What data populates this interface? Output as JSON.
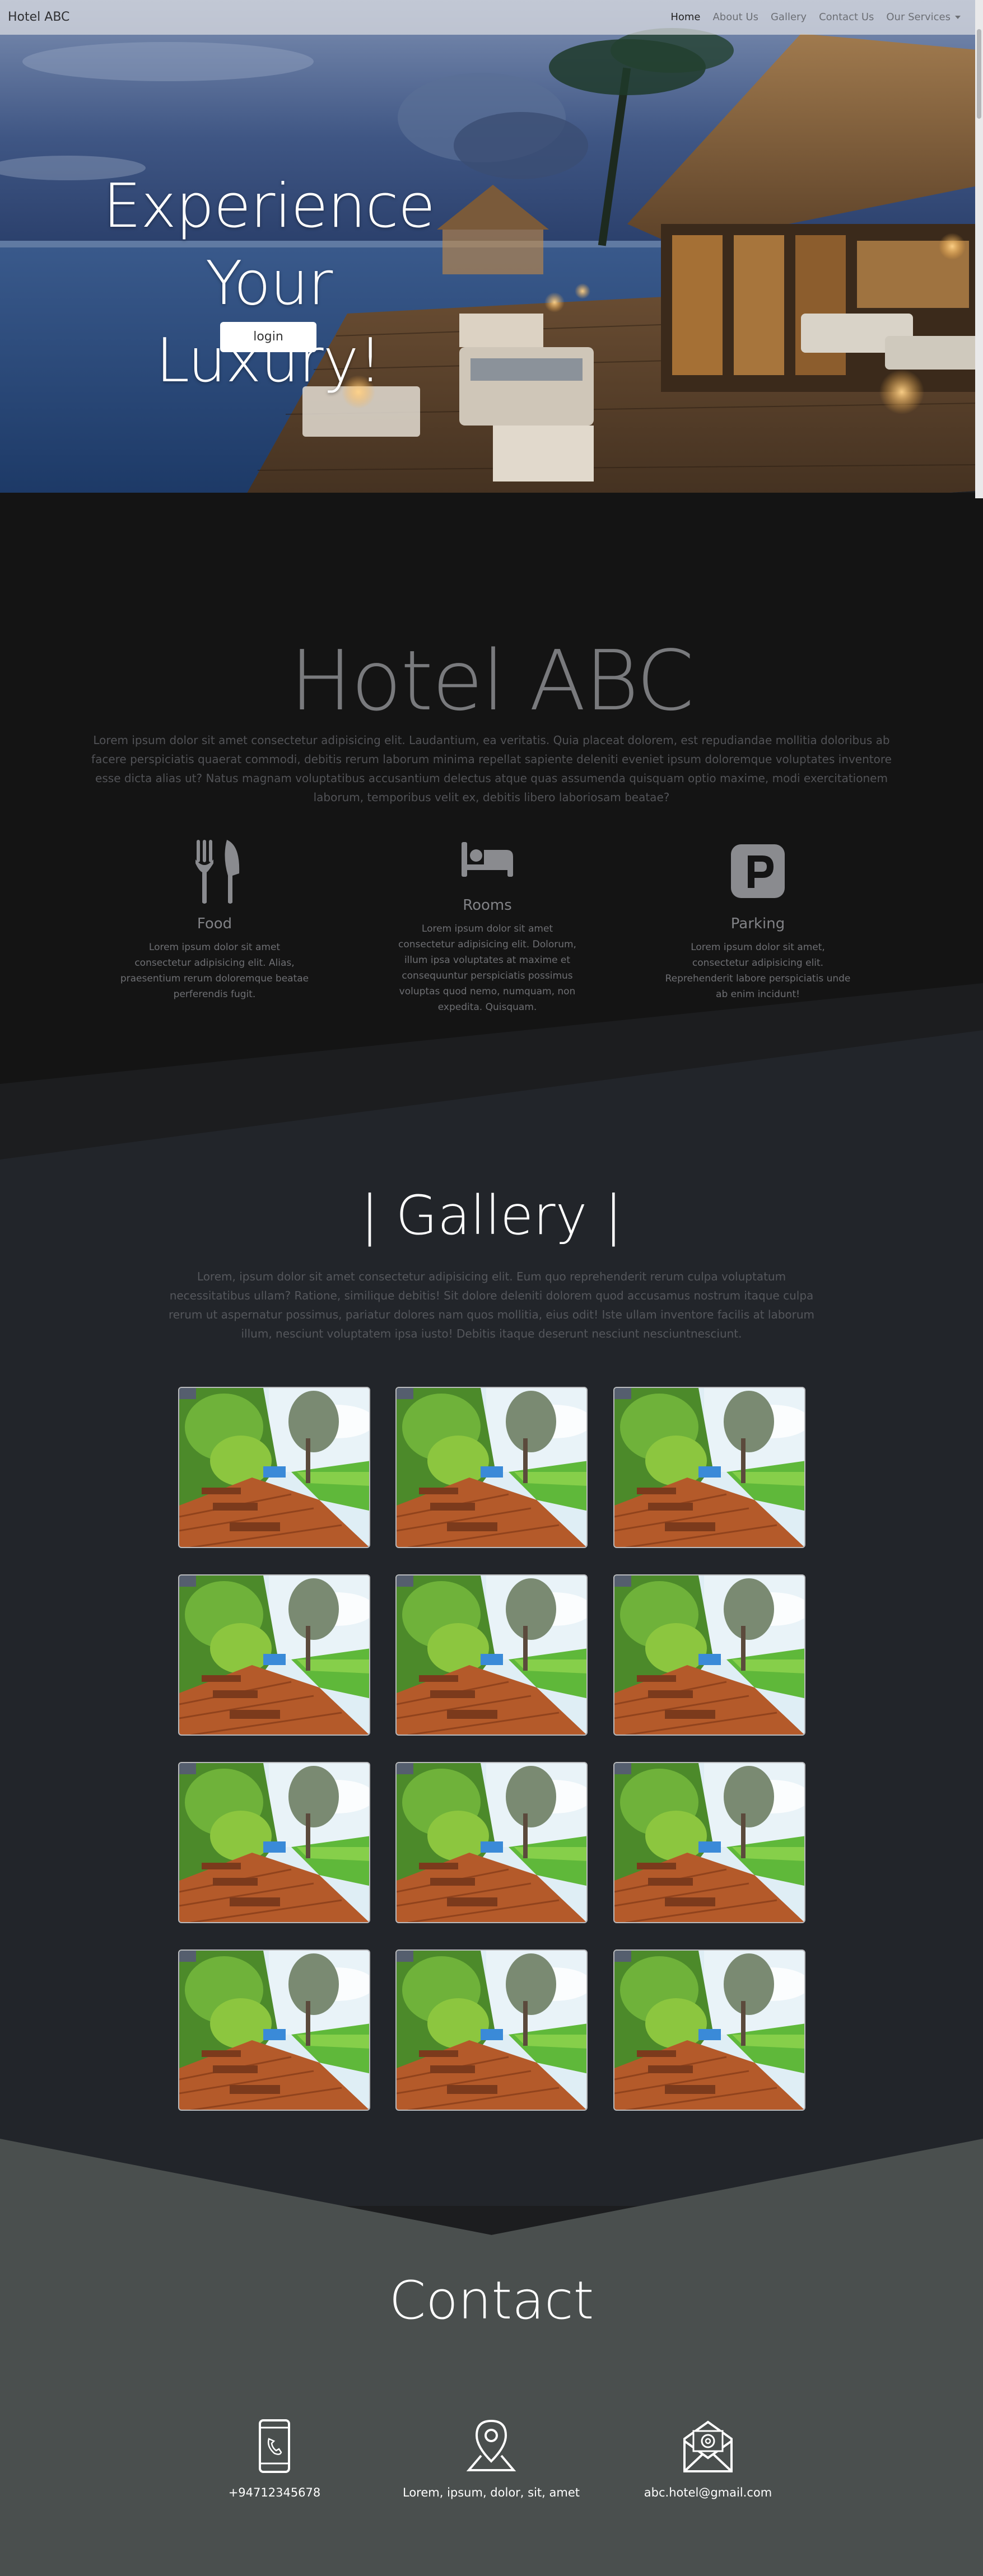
{
  "navbar": {
    "brand": "Hotel ABC",
    "links": [
      "Home",
      "About Us",
      "Gallery",
      "Contact Us"
    ],
    "dropdown_label": "Our Services"
  },
  "hero": {
    "title_line1": "Experience",
    "title_line2": "Your Luxury!",
    "login_label": "login"
  },
  "about": {
    "title": "Hotel ABC",
    "text": "Lorem ipsum dolor sit amet consectetur adipisicing elit. Laudantium, ea veritatis. Quia placeat dolorem, est repudiandae mollitia doloribus ab facere perspiciatis quaerat commodi, debitis rerum laborum minima repellat sapiente deleniti eveniet ipsum doloremque voluptates inventore esse dicta alias ut? Natus magnam voluptatibus accusantium delectus atque quas assumenda quisquam optio maxime, modi exercitationem laborum, temporibus velit ex, debitis libero laboriosam beatae?",
    "features": [
      {
        "icon": "fork-knife-icon",
        "title": "Food",
        "text": "Lorem ipsum dolor sit amet consectetur adipisicing elit. Alias, praesentium rerum doloremque beatae perferendis fugit."
      },
      {
        "icon": "bed-icon",
        "title": "Rooms",
        "text": "Lorem ipsum dolor sit amet consectetur adipisicing elit. Dolorum, illum ipsa voluptates at maxime et consequuntur perspiciatis possimus voluptas quod nemo, numquam, non expedita. Quisquam."
      },
      {
        "icon": "parking-icon",
        "title": "Parking",
        "text": "Lorem ipsum dolor sit amet, consectetur adipisicing elit. Reprehenderit labore perspiciatis unde ab enim incidunt!"
      }
    ]
  },
  "gallery": {
    "title": "| Gallery |",
    "text": "Lorem, ipsum dolor sit amet consectetur adipisicing elit. Eum quo reprehenderit rerum culpa voluptatum necessitatibus ullam? Ratione, similique debitis! Sit dolore deleniti dolorem quod accusamus nostrum itaque culpa rerum ut aspernatur possimus, pariatur dolores nam quos mollitia, eius odit! Iste ullam inventore facilis at laborum illum, nesciunt voluptatem ipsa iusto! Debitis itaque deserunt nesciunt nesciuntnesciunt.",
    "image_count": 12
  },
  "contact": {
    "title": "Contact",
    "items": [
      {
        "icon": "phone-icon",
        "label": "+94712345678"
      },
      {
        "icon": "location-pin-icon",
        "label": "Lorem, ipsum, dolor, sit, amet"
      },
      {
        "icon": "email-icon",
        "label": "abc.hotel@gmail.com"
      }
    ]
  }
}
